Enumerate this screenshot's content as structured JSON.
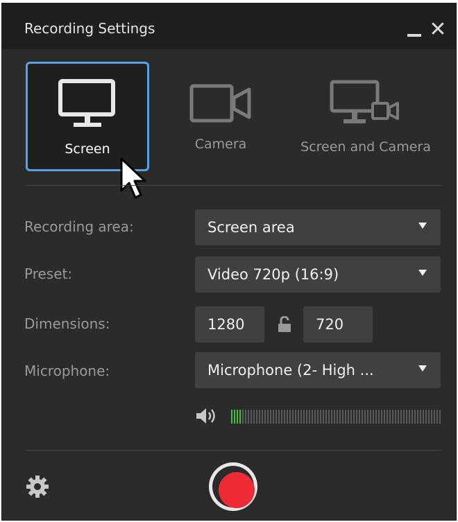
{
  "window": {
    "title": "Recording Settings"
  },
  "modes": [
    {
      "label": "Screen",
      "selected": true,
      "icon": "monitor-icon"
    },
    {
      "label": "Camera",
      "selected": false,
      "icon": "video-camera-icon"
    },
    {
      "label": "Screen and Camera",
      "selected": false,
      "icon": "monitor-camera-icon"
    }
  ],
  "settings": {
    "recording_area": {
      "label": "Recording area:",
      "value": "Screen area"
    },
    "preset": {
      "label": "Preset:",
      "value": "Video 720p (16:9)"
    },
    "dimensions": {
      "label": "Dimensions:",
      "width": "1280",
      "height": "720",
      "lock_icon": "unlocked-padlock-icon"
    },
    "microphone": {
      "label": "Microphone:",
      "value": "Microphone (2- High ..."
    },
    "mic_level": {
      "fraction": 0.05,
      "icon": "speaker-icon"
    }
  },
  "footer": {
    "settings_icon": "gear-icon",
    "record_icon": "record-icon"
  },
  "colors": {
    "background": "#2b2b2b",
    "titlebar": "#1f1f1f",
    "selected_border": "#5aa0e6",
    "record": "#ee2a35",
    "level": "#3fc43f"
  }
}
